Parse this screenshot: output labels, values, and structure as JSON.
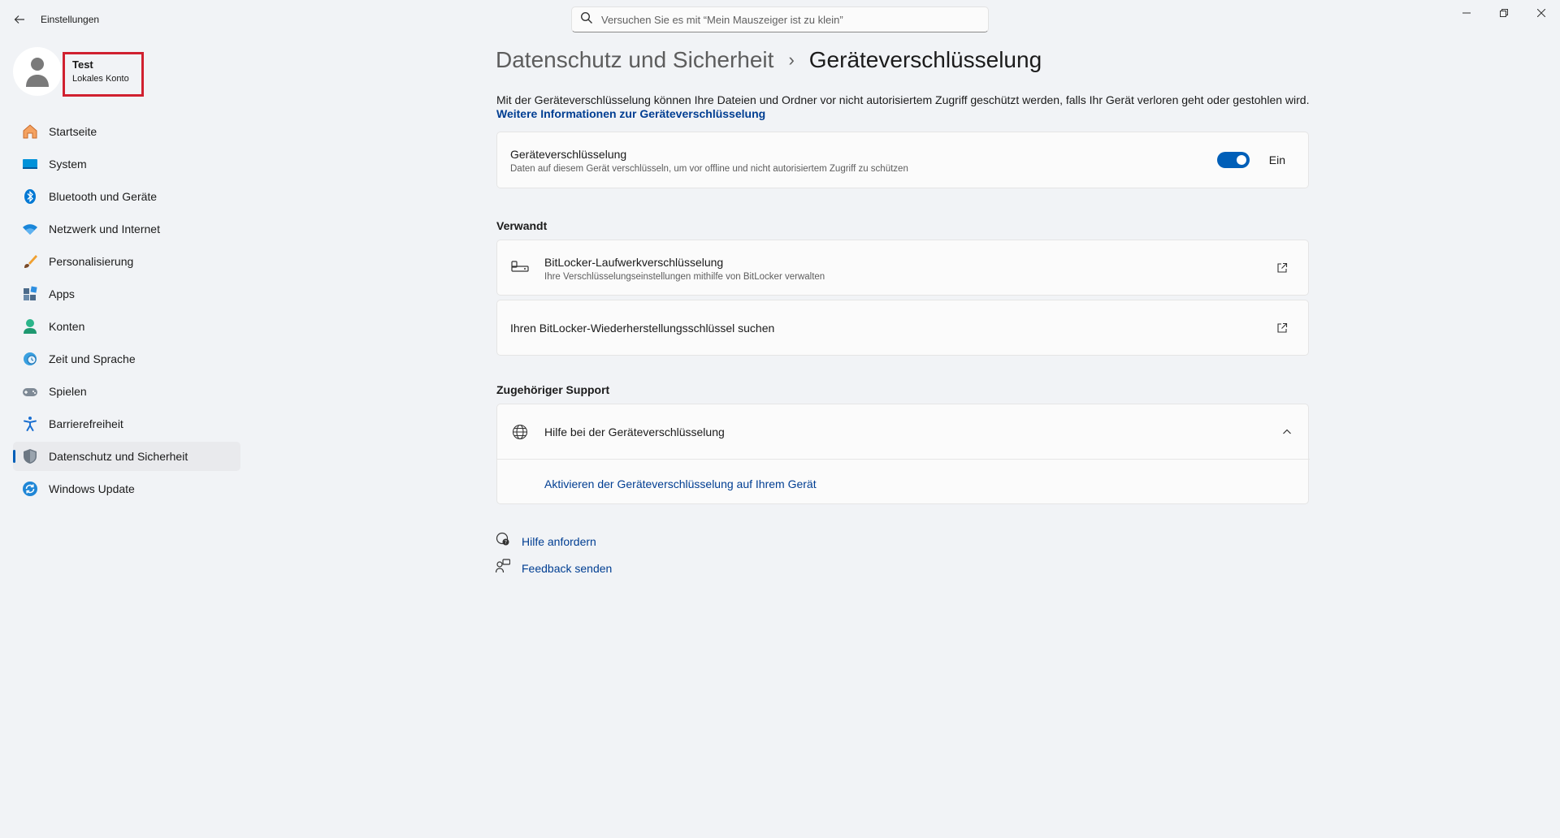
{
  "window": {
    "title": "Einstellungen",
    "search_placeholder": "Versuchen Sie es mit “Mein Mauszeiger ist zu klein”"
  },
  "profile": {
    "name": "Test",
    "account_type": "Lokales Konto"
  },
  "sidebar": {
    "items": [
      {
        "label": "Startseite",
        "icon": "home-icon"
      },
      {
        "label": "System",
        "icon": "system-icon"
      },
      {
        "label": "Bluetooth und Geräte",
        "icon": "bluetooth-icon"
      },
      {
        "label": "Netzwerk und Internet",
        "icon": "wifi-icon"
      },
      {
        "label": "Personalisierung",
        "icon": "brush-icon"
      },
      {
        "label": "Apps",
        "icon": "apps-icon"
      },
      {
        "label": "Konten",
        "icon": "accounts-icon"
      },
      {
        "label": "Zeit und Sprache",
        "icon": "time-language-icon"
      },
      {
        "label": "Spielen",
        "icon": "gaming-icon"
      },
      {
        "label": "Barrierefreiheit",
        "icon": "accessibility-icon"
      },
      {
        "label": "Datenschutz und Sicherheit",
        "icon": "shield-icon",
        "active": true
      },
      {
        "label": "Windows Update",
        "icon": "windows-update-icon"
      }
    ]
  },
  "breadcrumb": {
    "parent": "Datenschutz und Sicherheit",
    "separator": "›",
    "current": "Geräteverschlüsselung"
  },
  "intro": {
    "text": "Mit der Geräteverschlüsselung können Ihre Dateien und Ordner vor nicht autorisiertem Zugriff geschützt werden, falls Ihr Gerät verloren geht oder gestohlen wird.",
    "link": "Weitere Informationen zur Geräteverschlüsselung"
  },
  "encryption": {
    "title": "Geräteverschlüsselung",
    "description": "Daten auf diesem Gerät verschlüsseln, um vor offline und nicht autorisiertem Zugriff zu schützen",
    "toggle_state": "Ein",
    "enabled": true
  },
  "related": {
    "heading": "Verwandt",
    "bitlocker": {
      "title": "BitLocker-Laufwerkverschlüsselung",
      "description": "Ihre Verschlüsselungseinstellungen mithilfe von BitLocker verwalten"
    },
    "recovery_key": {
      "title": "Ihren BitLocker-Wiederherstellungsschlüssel suchen"
    }
  },
  "support": {
    "heading": "Zugehöriger Support",
    "help_title": "Hilfe bei der Geräteverschlüsselung",
    "help_link": "Aktivieren der Geräteverschlüsselung auf Ihrem Gerät"
  },
  "footer": {
    "get_help": "Hilfe anfordern",
    "feedback": "Feedback senden"
  },
  "colors": {
    "accent": "#005fb8",
    "link": "#003e92",
    "highlight_border": "#d0202f"
  }
}
